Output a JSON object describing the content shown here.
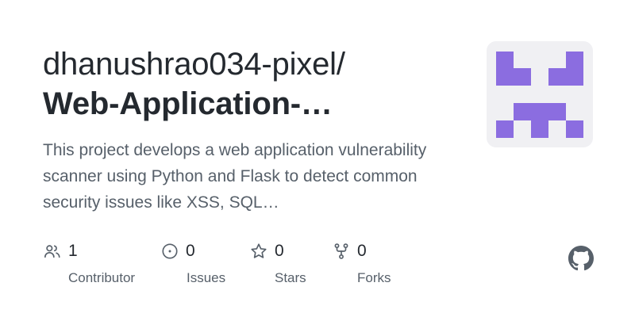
{
  "repo": {
    "owner": "dhanushrao034-pixel/",
    "name": "Web-Application-…",
    "description": "This project develops a web application vulnerability scanner using Python and Flask to detect common security issues like XSS, SQL…"
  },
  "stats": [
    {
      "icon": "people-icon",
      "value": "1",
      "label": "Contributor"
    },
    {
      "icon": "issue-circle-icon",
      "value": "0",
      "label": "Issues"
    },
    {
      "icon": "star-icon",
      "value": "0",
      "label": "Stars"
    },
    {
      "icon": "fork-icon",
      "value": "0",
      "label": "Forks"
    }
  ],
  "colors": {
    "identicon": "#8b6de0",
    "avatar_bg": "#f0f0f3",
    "text_primary": "#24292f",
    "text_secondary": "#57606a"
  },
  "icons": {
    "avatar": "identicon",
    "brand": "github-mark-icon"
  }
}
